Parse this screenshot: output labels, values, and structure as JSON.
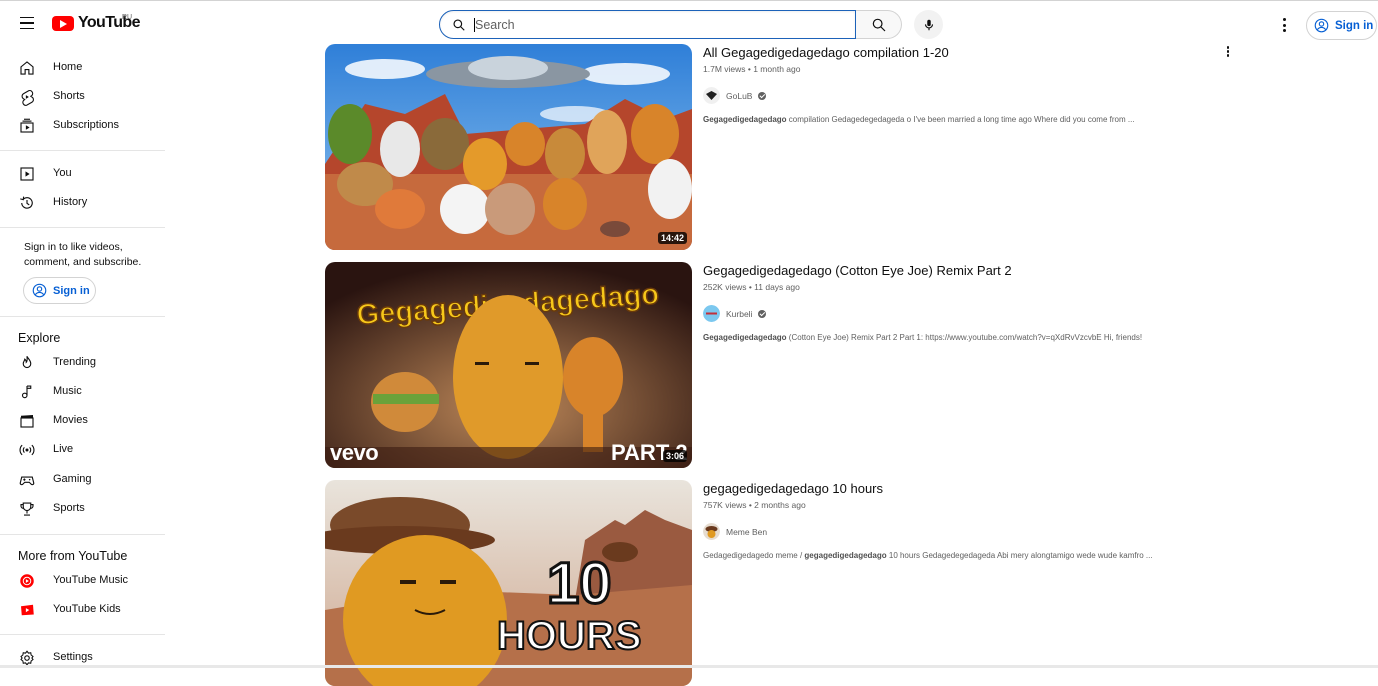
{
  "header": {
    "logo_text": "YouTube",
    "country_code": "RU",
    "search_placeholder": "Search",
    "signin_label": "Sign in"
  },
  "sidebar": {
    "main": [
      {
        "label": "Home",
        "icon": "home-icon"
      },
      {
        "label": "Shorts",
        "icon": "shorts-icon"
      },
      {
        "label": "Subscriptions",
        "icon": "subscriptions-icon"
      }
    ],
    "you": [
      {
        "label": "You",
        "icon": "you-icon"
      },
      {
        "label": "History",
        "icon": "history-icon"
      }
    ],
    "signin_note": "Sign in to like videos, comment, and subscribe.",
    "signin_label": "Sign in",
    "explore_title": "Explore",
    "explore": [
      {
        "label": "Trending",
        "icon": "trending-icon"
      },
      {
        "label": "Music",
        "icon": "music-icon"
      },
      {
        "label": "Movies",
        "icon": "movies-icon"
      },
      {
        "label": "Live",
        "icon": "live-icon"
      },
      {
        "label": "Gaming",
        "icon": "gaming-icon"
      },
      {
        "label": "Sports",
        "icon": "sports-icon"
      }
    ],
    "more_title": "More from YouTube",
    "more": [
      {
        "label": "YouTube Music",
        "icon": "youtube-music-icon"
      },
      {
        "label": "YouTube Kids",
        "icon": "youtube-kids-icon"
      }
    ],
    "settings": {
      "label": "Settings",
      "icon": "settings-icon"
    }
  },
  "videos": [
    {
      "title": "All Gegagedigedagedago compilation 1-20",
      "views": "1.7M views",
      "age": "1 month ago",
      "channel": "GoLuB",
      "verified": true,
      "desc_bold": "Gegagedigedagedago",
      "desc_rest": " compilation Gedagedegedageda o I've been married a long time ago Where did you come from  ...",
      "duration": "14:42"
    },
    {
      "title": "Gegagedigedagedago (Cotton Eye Joe) Remix Part 2",
      "views": "252K views",
      "age": "11 days ago",
      "channel": "Kurbeli",
      "verified": true,
      "desc_bold": "Gegagedigedagedago",
      "desc_rest": " (Cotton Eye Joe) Remix Part 2 Part 1: https://www.youtube.com/watch?v=qXdRvVzcvbE Hi, friends!",
      "duration": "3:06",
      "thumb_title": "Gegagedigedagedago",
      "thumb_brand": "vevo",
      "thumb_part": "PART 2"
    },
    {
      "title": "gegagedigedagedago 10 hours",
      "views": "757K views",
      "age": "2 months ago",
      "channel": "Meme Ben",
      "verified": false,
      "desc_pre": "Gedagedigedagedo meme / ",
      "desc_bold": "gegagedigedagedago",
      "desc_rest": " 10 hours Gedagedegedageda Abi mery alongtamigo wede wude kamfro ...",
      "thumb_big": "10",
      "thumb_hours": "HOURS"
    }
  ]
}
